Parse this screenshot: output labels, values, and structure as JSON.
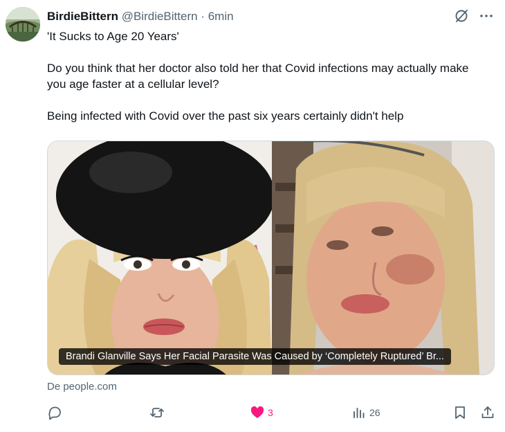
{
  "post": {
    "display_name": "BirdieBittern",
    "handle": "@BirdieBittern",
    "separator": "·",
    "time": "6min",
    "body": [
      "'It Sucks to Age 20 Years'",
      "Do you think that her doctor also told her that Covid infections may actually make you age faster at a cellular level?",
      "Being infected with Covid over the past six years certainly didn't help"
    ],
    "card_caption": "Brandi Glanville Says Her Facial Parasite Was Caused by ‘Completely Ruptured’ Br...",
    "source": "De people.com"
  },
  "header_icons": [
    "grok-slash-icon",
    "more-icon"
  ],
  "actions": {
    "reply": "",
    "repost": "",
    "like": "3",
    "views": "26"
  },
  "colors": {
    "text": "#0f1419",
    "secondary": "#536471",
    "like": "#f91880",
    "border": "#cfd9de"
  }
}
